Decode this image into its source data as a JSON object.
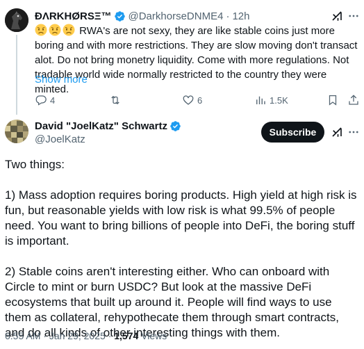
{
  "reply": {
    "author_name": "ÐΛRKHØRSΞ™",
    "handle": "@DarkhorseDNME4",
    "separator": "·",
    "time": "12h",
    "emojis": [
      "disappointed-face",
      "disappointed-face",
      "disappointed-face"
    ],
    "text": "RWA's are not sexy, they are like stable coins just more boring and with more restrictions. They are slow moving don't transact alot. Do not bring monetry liquidity. Come with more regulations. Not tradable world wide normally restricted to the country they were minted.",
    "show_more": "Show more",
    "actions": {
      "replies": "4",
      "reposts": "",
      "likes": "6",
      "views": "1.5K"
    }
  },
  "main": {
    "author_name": "David \"JoelKatz\" Schwartz",
    "handle": "@JoelKatz",
    "subscribe_label": "Subscribe",
    "paragraphs": [
      "Two things:",
      "1) Mass adoption requires boring products. High yield at high risk is fun, but reasonable yields with low risk is what 99.5% of people need. You want to bring billions of people into DeFi, the boring stuff is important.",
      "2) Stable coins aren't interesting either. Who can onboard with Circle to mint or burn USDC? But look at the massive DeFi ecosystems that built up around it. People will find ways to use them as collateral, rehypothecate them through smart contracts, and do all kinds of other interesting things with them."
    ],
    "meta": {
      "time": "6:55 AM",
      "separator": "·",
      "date": "Jan 29, 2025",
      "separator2": "·",
      "views_count": "1,574",
      "views_label": "Views"
    }
  },
  "colors": {
    "accent": "#1d9bf0",
    "text": "#0f1419",
    "muted": "#536471",
    "thread_line": "#cfd9de"
  }
}
